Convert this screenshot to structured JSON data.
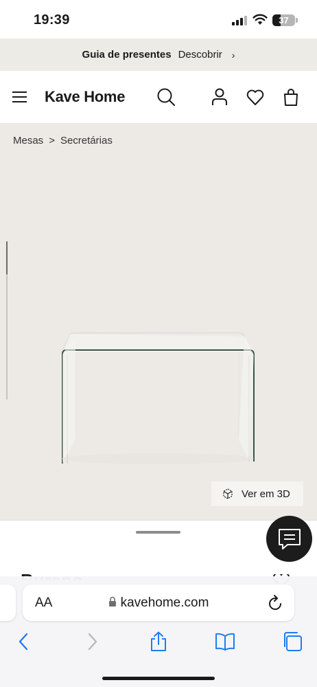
{
  "status_bar": {
    "time": "19:39",
    "battery_level": "37",
    "icons": [
      "signal-icon",
      "wifi-icon",
      "battery-icon"
    ]
  },
  "promo_banner": {
    "title": "Guia de presentes",
    "link_label": "Descobrir",
    "chevron": "›"
  },
  "header": {
    "logo": "Kave Home",
    "icons": [
      "menu-icon",
      "search-icon",
      "account-icon",
      "wishlist-icon",
      "cart-icon"
    ]
  },
  "breadcrumb": {
    "items": [
      "Mesas",
      "Secretárias"
    ],
    "separator": ">"
  },
  "gallery": {
    "image_alt": "glass-desk",
    "view_3d_label": "Ver em 3D"
  },
  "product": {
    "partial_title": "Burano"
  },
  "browser": {
    "text_size_label": "AA",
    "url": "kavehome.com",
    "accent_color": "#1a73e8",
    "icons": [
      "back-icon",
      "forward-icon",
      "share-icon",
      "bookmarks-icon",
      "tabs-icon",
      "reload-icon",
      "lock-icon"
    ]
  },
  "colors": {
    "promo_bg": "#edebe6",
    "gallery_bg": "#edeae5",
    "chat_bg": "#1c1c1c",
    "safari_blue": "#1f7cf0"
  }
}
